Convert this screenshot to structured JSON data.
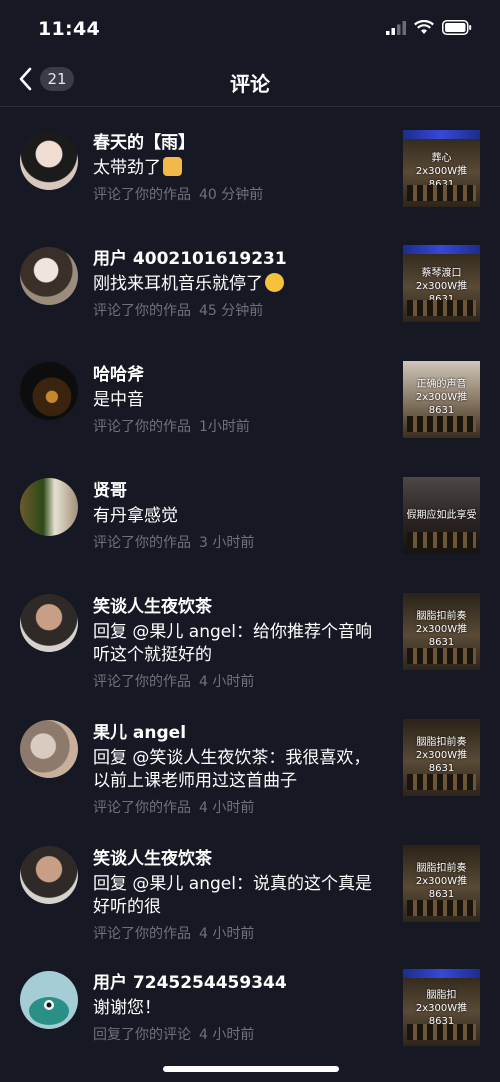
{
  "status_bar": {
    "time": "11:44"
  },
  "header": {
    "badge_count": "21",
    "title": "评论"
  },
  "comments": [
    {
      "username": "春天的【雨】",
      "text": "太带劲了",
      "emoji": "thumbs-up",
      "action": "评论了你的作品",
      "time": "40 分钟前",
      "thumbnail_text": "葬心\n2x300W推8631\n请戴  耳机"
    },
    {
      "username": "用户 4002101619231",
      "text": "刚找来耳机音乐就停了",
      "emoji": "smirk-face",
      "action": "评论了你的作品",
      "time": "45 分钟前",
      "thumbnail_text": "蔡琴渡口\n2x300W推8631\n请戴  聆听"
    },
    {
      "username": "哈哈斧",
      "text": "是中音",
      "action": "评论了你的作品",
      "time": "1小时前",
      "thumbnail_text": "正确的声音\n2x300W推8631\n请戴  聆赏"
    },
    {
      "username": "贤哥",
      "text": "有丹拿感觉",
      "action": "评论了你的作品",
      "time": "3 小时前",
      "thumbnail_text": "假期应如此享受"
    },
    {
      "username": "笑谈人生夜饮茶",
      "text": "回复 @果儿 angel：给你推荐个音响听这个就挺好的",
      "action": "评论了你的作品",
      "time": "4 小时前",
      "thumbnail_text": "胭脂扣前奏\n2x300W推8631\n务必戴  耳机听"
    },
    {
      "username": "果儿 angel",
      "text": "回复 @笑谈人生夜饮茶：我很喜欢，以前上课老师用过这首曲子",
      "action": "评论了你的作品",
      "time": "4 小时前",
      "thumbnail_text": "胭脂扣前奏\n2x300W推8631\n务必戴  耳机听"
    },
    {
      "username": "笑谈人生夜饮茶",
      "text": "回复 @果儿 angel：说真的这个真是好听的很",
      "action": "评论了你的作品",
      "time": "4 小时前",
      "thumbnail_text": "胭脂扣前奏\n2x300W推8631\n务必戴  耳机听"
    },
    {
      "username": "用户 7245254459344",
      "text": "谢谢您！",
      "action": "回复了你的评论",
      "time": "4 小时前",
      "thumbnail_text": "胭脂扣\n2x300W推8631\n必戴  耳机"
    }
  ],
  "colors": {
    "background": "#161823",
    "meta_text": "#6f717b",
    "badge": "#3a3c47"
  }
}
